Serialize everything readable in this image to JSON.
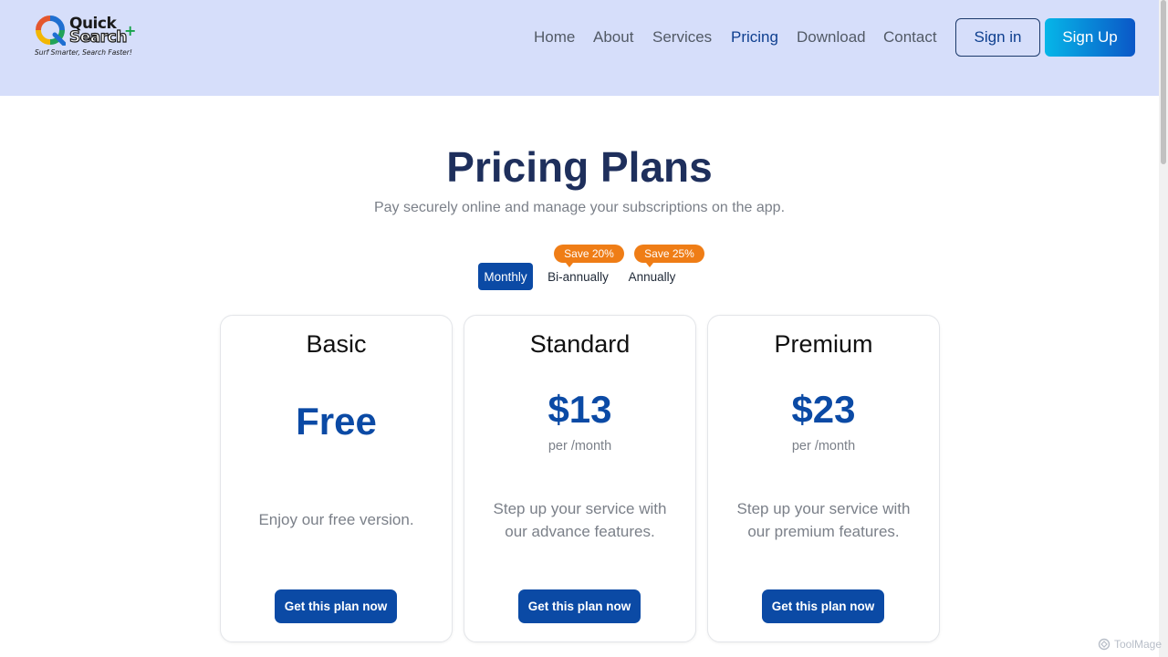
{
  "brand": {
    "name_line1": "Quick",
    "name_line2": "Search",
    "plus": "+",
    "tagline": "Surf Smarter, Search Faster!"
  },
  "nav": {
    "items": [
      {
        "label": "Home"
      },
      {
        "label": "About"
      },
      {
        "label": "Services"
      },
      {
        "label": "Pricing",
        "active": true
      },
      {
        "label": "Download"
      },
      {
        "label": "Contact"
      }
    ],
    "signin_label": "Sign in",
    "signup_label": "Sign Up"
  },
  "hero": {
    "title": "Pricing Plans",
    "subtitle": "Pay securely online and manage your subscriptions on the app."
  },
  "billing": {
    "options": [
      {
        "label": "Monthly",
        "selected": true
      },
      {
        "label": "Bi-annually",
        "badge": "Save 20%"
      },
      {
        "label": "Annually",
        "badge": "Save 25%"
      }
    ]
  },
  "plans": [
    {
      "name": "Basic",
      "price": "Free",
      "period": "",
      "description": "Enjoy our free version.",
      "cta": "Get this plan now"
    },
    {
      "name": "Standard",
      "price": "$13",
      "period": "per /month",
      "description": "Step up your service with our advance features.",
      "cta": "Get this plan now"
    },
    {
      "name": "Premium",
      "price": "$23",
      "period": "per /month",
      "description": "Step up your service with our premium features.",
      "cta": "Get this plan now"
    }
  ],
  "watermark": "ToolMage",
  "colors": {
    "header_bg": "#d6defa",
    "primary": "#0b4aa5",
    "title": "#1e2f5c",
    "badge": "#ef7d16",
    "active_nav": "#0e3f8f"
  },
  "icons": {
    "logo": "quick-search-logo-icon",
    "watermark": "toolmage-icon"
  }
}
